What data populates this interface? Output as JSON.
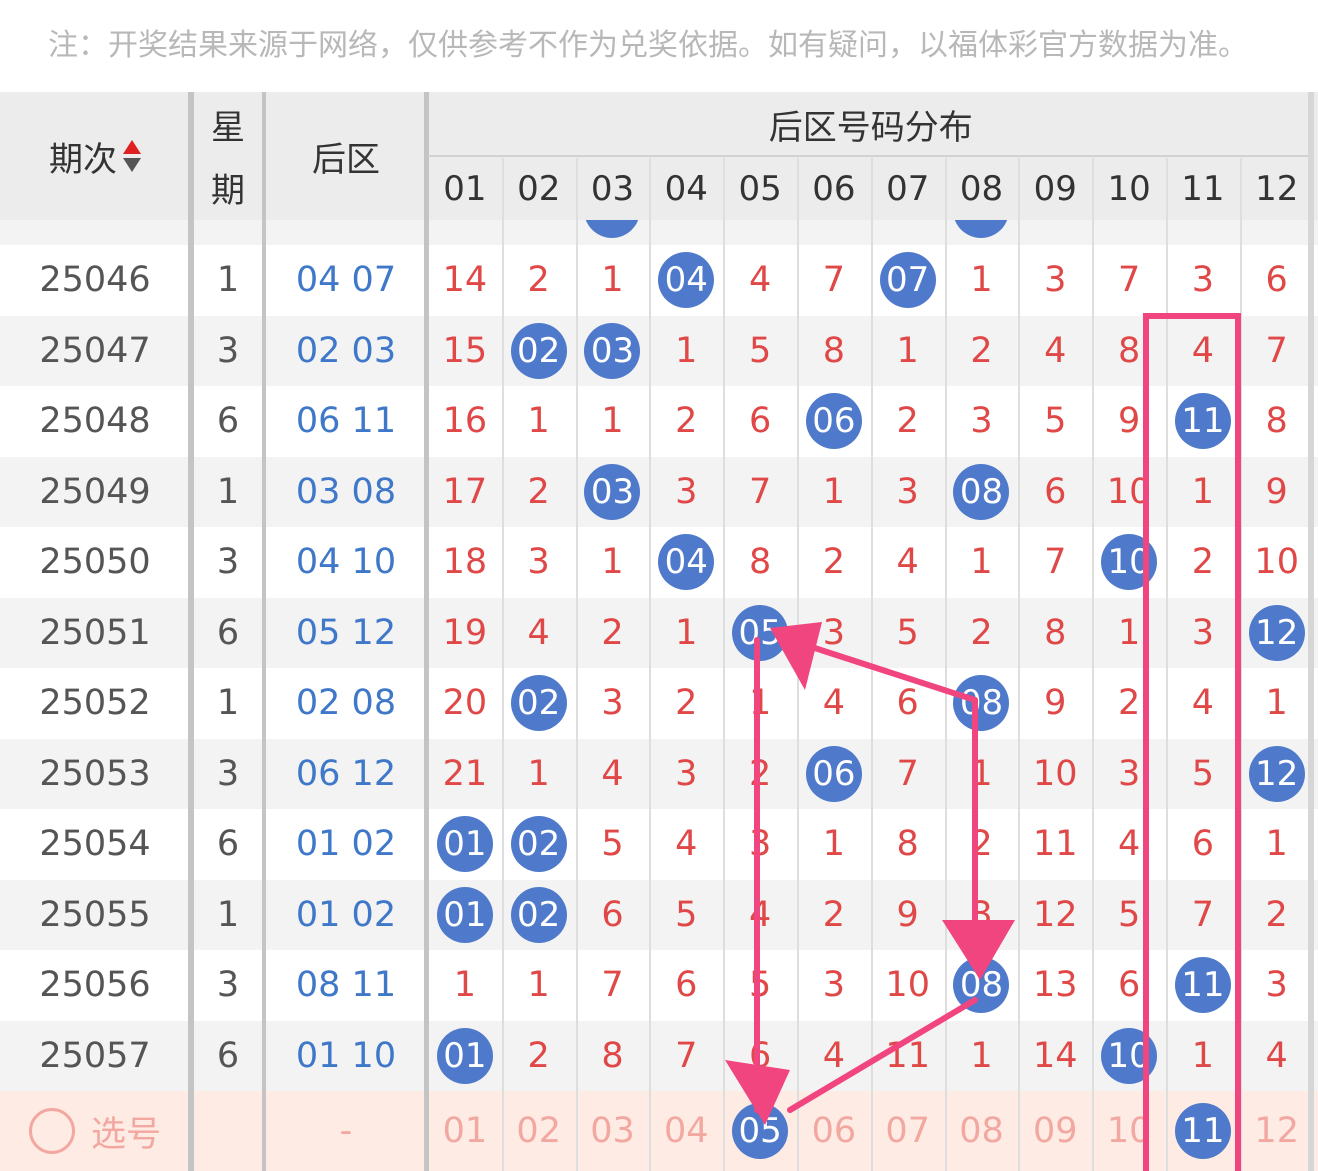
{
  "notice": "注：开奖结果来源于网络，仅供参考不作为兑奖依据。如有疑问，以福体彩官方数据为准。",
  "header": {
    "issue_label": "期次",
    "week_label_1": "星",
    "week_label_2": "期",
    "back_label": "后区",
    "dist_label": "后区号码分布",
    "columns": [
      "01",
      "02",
      "03",
      "04",
      "05",
      "06",
      "07",
      "08",
      "09",
      "10",
      "11",
      "12"
    ]
  },
  "partial_row": {
    "balls": [
      3,
      8
    ]
  },
  "rows": [
    {
      "issue": "25046",
      "week": "1",
      "b1": "04",
      "b2": "07",
      "cells": [
        "14",
        "2",
        "1",
        "04",
        "4",
        "7",
        "07",
        "1",
        "3",
        "7",
        "3",
        "6"
      ],
      "balls": [
        4,
        7
      ]
    },
    {
      "issue": "25047",
      "week": "3",
      "b1": "02",
      "b2": "03",
      "cells": [
        "15",
        "02",
        "03",
        "1",
        "5",
        "8",
        "1",
        "2",
        "4",
        "8",
        "4",
        "7"
      ],
      "balls": [
        2,
        3
      ]
    },
    {
      "issue": "25048",
      "week": "6",
      "b1": "06",
      "b2": "11",
      "cells": [
        "16",
        "1",
        "1",
        "2",
        "6",
        "06",
        "2",
        "3",
        "5",
        "9",
        "11",
        "8"
      ],
      "balls": [
        6,
        11
      ]
    },
    {
      "issue": "25049",
      "week": "1",
      "b1": "03",
      "b2": "08",
      "cells": [
        "17",
        "2",
        "03",
        "3",
        "7",
        "1",
        "3",
        "08",
        "6",
        "10",
        "1",
        "9"
      ],
      "balls": [
        3,
        8
      ]
    },
    {
      "issue": "25050",
      "week": "3",
      "b1": "04",
      "b2": "10",
      "cells": [
        "18",
        "3",
        "1",
        "04",
        "8",
        "2",
        "4",
        "1",
        "7",
        "10",
        "2",
        "10"
      ],
      "balls": [
        4,
        10
      ]
    },
    {
      "issue": "25051",
      "week": "6",
      "b1": "05",
      "b2": "12",
      "cells": [
        "19",
        "4",
        "2",
        "1",
        "05",
        "3",
        "5",
        "2",
        "8",
        "1",
        "3",
        "12"
      ],
      "balls": [
        5,
        12
      ]
    },
    {
      "issue": "25052",
      "week": "1",
      "b1": "02",
      "b2": "08",
      "cells": [
        "20",
        "02",
        "3",
        "2",
        "1",
        "4",
        "6",
        "08",
        "9",
        "2",
        "4",
        "1"
      ],
      "balls": [
        2,
        8
      ]
    },
    {
      "issue": "25053",
      "week": "3",
      "b1": "06",
      "b2": "12",
      "cells": [
        "21",
        "1",
        "4",
        "3",
        "2",
        "06",
        "7",
        "1",
        "10",
        "3",
        "5",
        "12"
      ],
      "balls": [
        6,
        12
      ]
    },
    {
      "issue": "25054",
      "week": "6",
      "b1": "01",
      "b2": "02",
      "cells": [
        "01",
        "02",
        "5",
        "4",
        "3",
        "1",
        "8",
        "2",
        "11",
        "4",
        "6",
        "1"
      ],
      "balls": [
        1,
        2
      ]
    },
    {
      "issue": "25055",
      "week": "1",
      "b1": "01",
      "b2": "02",
      "cells": [
        "01",
        "02",
        "6",
        "5",
        "4",
        "2",
        "9",
        "3",
        "12",
        "5",
        "7",
        "2"
      ],
      "balls": [
        1,
        2
      ]
    },
    {
      "issue": "25056",
      "week": "3",
      "b1": "08",
      "b2": "11",
      "cells": [
        "1",
        "1",
        "7",
        "6",
        "5",
        "3",
        "10",
        "08",
        "13",
        "6",
        "11",
        "3"
      ],
      "balls": [
        8,
        11
      ]
    },
    {
      "issue": "25057",
      "week": "6",
      "b1": "01",
      "b2": "10",
      "cells": [
        "01",
        "2",
        "8",
        "7",
        "6",
        "4",
        "11",
        "1",
        "14",
        "10",
        "1",
        "4"
      ],
      "balls": [
        1,
        10
      ]
    }
  ],
  "select_row": {
    "label": "选号",
    "dash": "-",
    "cells": [
      "01",
      "02",
      "03",
      "04",
      "05",
      "06",
      "07",
      "08",
      "09",
      "10",
      "11",
      "12"
    ],
    "selected": [
      5,
      11
    ]
  },
  "colors": {
    "ball": "#4f7acb",
    "miss": "#e04848",
    "back": "#3f78c9",
    "annotation": "#f0457e"
  }
}
